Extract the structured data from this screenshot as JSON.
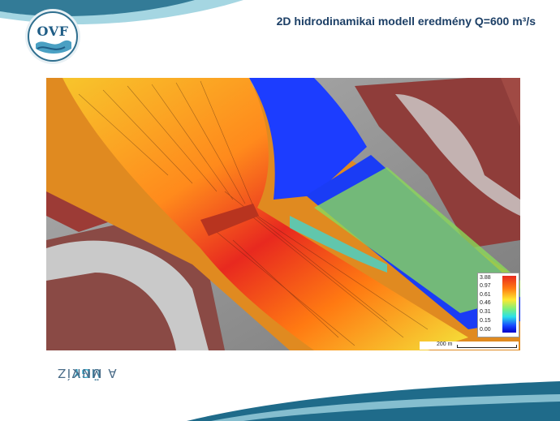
{
  "header": {
    "title": "2D hidrodinamikai modell eredmény Q=600 m³/s",
    "logo_text": "OVF"
  },
  "sidebar": {
    "slogan_part1": "A MI VÍZ",
    "slogan_accent": "ÜGY",
    "slogan_part2": "ÜNK"
  },
  "map": {
    "legend_values": [
      "3.88",
      "0.97",
      "0.61",
      "0.46",
      "0.31",
      "0.15",
      "0.00"
    ],
    "scale_label": "200 m"
  },
  "colors": {
    "title": "#1c3f66",
    "accent": "#29a6c8",
    "swoosh_dark": "#1f6b8a",
    "swoosh_light": "#9fd3e0"
  }
}
